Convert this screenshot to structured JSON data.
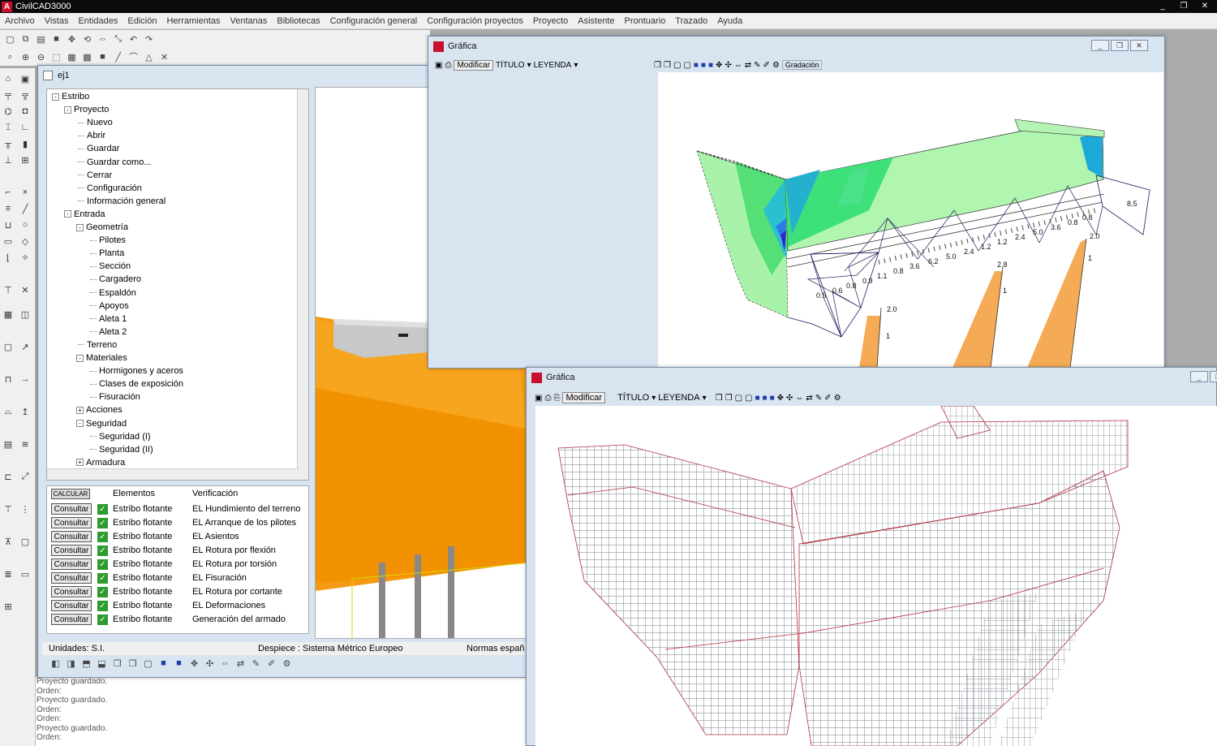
{
  "app": {
    "title": "CivilCAD3000",
    "logo_letter": "A"
  },
  "window_controls": {
    "minimize": "_",
    "restore": "❐",
    "close": "✕"
  },
  "menu": [
    "Archivo",
    "Vistas",
    "Entidades",
    "Edición",
    "Herramientas",
    "Ventanas",
    "Bibliotecas",
    "Configuración general",
    "Configuración proyectos",
    "Proyecto",
    "Asistente",
    "Prontuario",
    "Trazado",
    "Ayuda"
  ],
  "doc": {
    "title": "ej1"
  },
  "tree": [
    {
      "label": "Estribo",
      "level": 0,
      "exp": "-"
    },
    {
      "label": "Proyecto",
      "level": 1,
      "exp": "-"
    },
    {
      "label": "Nuevo",
      "level": 2
    },
    {
      "label": "Abrir",
      "level": 2
    },
    {
      "label": "Guardar",
      "level": 2
    },
    {
      "label": "Guardar como...",
      "level": 2
    },
    {
      "label": "Cerrar",
      "level": 2
    },
    {
      "label": "Configuración",
      "level": 2
    },
    {
      "label": "Información general",
      "level": 2
    },
    {
      "label": "Entrada",
      "level": 1,
      "exp": "-"
    },
    {
      "label": "Geometría",
      "level": 2,
      "exp": "-"
    },
    {
      "label": "Pilotes",
      "level": 3
    },
    {
      "label": "Planta",
      "level": 3
    },
    {
      "label": "Sección",
      "level": 3
    },
    {
      "label": "Cargadero",
      "level": 3
    },
    {
      "label": "Espaldón",
      "level": 3
    },
    {
      "label": "Apoyos",
      "level": 3
    },
    {
      "label": "Aleta 1",
      "level": 3
    },
    {
      "label": "Aleta 2",
      "level": 3
    },
    {
      "label": "Terreno",
      "level": 2
    },
    {
      "label": "Materiales",
      "level": 2,
      "exp": "-"
    },
    {
      "label": "Hormigones y aceros",
      "level": 3
    },
    {
      "label": "Clases de exposición",
      "level": 3
    },
    {
      "label": "Fisuración",
      "level": 3
    },
    {
      "label": "Acciones",
      "level": 2,
      "exp": "+"
    },
    {
      "label": "Seguridad",
      "level": 2,
      "exp": "-"
    },
    {
      "label": "Seguridad (I)",
      "level": 3
    },
    {
      "label": "Seguridad (II)",
      "level": 3
    },
    {
      "label": "Armadura",
      "level": 2,
      "exp": "+"
    }
  ],
  "grid": {
    "calc_label": "CALCULAR",
    "headers": [
      "Elementos",
      "Verificación"
    ],
    "consult_label": "Consultar",
    "rows": [
      {
        "element": "Estribo flotante",
        "check": "EL Hundimiento del terreno"
      },
      {
        "element": "Estribo flotante",
        "check": "EL Arranque de los pilotes"
      },
      {
        "element": "Estribo flotante",
        "check": "EL Asientos"
      },
      {
        "element": "Estribo flotante",
        "check": "EL Rotura por flexión"
      },
      {
        "element": "Estribo flotante",
        "check": "EL Rotura por torsión"
      },
      {
        "element": "Estribo flotante",
        "check": "EL Fisuración"
      },
      {
        "element": "Estribo flotante",
        "check": "EL Rotura por cortante"
      },
      {
        "element": "Estribo flotante",
        "check": "EL Deformaciones"
      },
      {
        "element": "Estribo flotante",
        "check": "Generación del armado"
      }
    ]
  },
  "status": {
    "units": "Unidades: S.I.",
    "despiece": "Despiece : Sistema Métrico Europeo",
    "normas": "Normas españ"
  },
  "console": [
    "Proyecto guardado.",
    "Orden:",
    "Proyecto guardado.",
    "Orden:",
    "Orden:",
    "Proyecto guardado.",
    "Orden:"
  ],
  "graph1": {
    "title": "Gráfica",
    "modify": "Modificar",
    "titulo": "TÍTULO",
    "leyenda": "LEYENDA",
    "gradacion": "Gradación",
    "labels": [
      "0.5",
      "0.6",
      "0.8",
      "0.9",
      "1.1",
      "0.8",
      "3.6",
      "6.2",
      "5.0",
      "2.4",
      "1.2",
      "1.2",
      "2.4",
      "5.0",
      "3.6",
      "0.8",
      "0.8",
      "8.5",
      "2.0",
      "2.8",
      "2.0",
      "1",
      "1",
      "1"
    ]
  },
  "graph2": {
    "title": "Gráfica",
    "modify": "Modificar",
    "titulo": "TÍTULO",
    "leyenda": "LEYENDA"
  },
  "colors": {
    "orange": "#f39200",
    "mesh_green": "#9be89b",
    "mesh_blue": "#3b6fe0",
    "rebar": "#9aa0a8"
  }
}
